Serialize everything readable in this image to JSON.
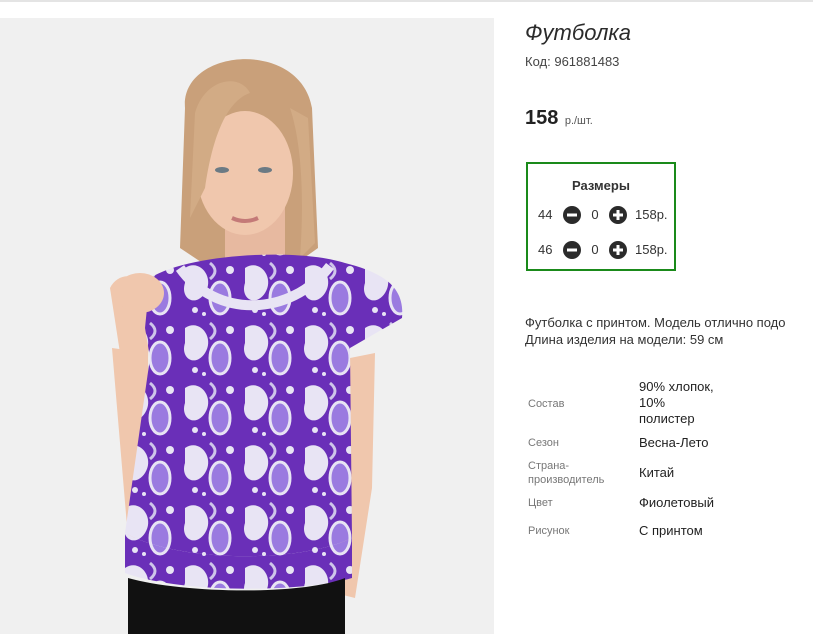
{
  "product": {
    "title": "Футболка",
    "code_label": "Код:",
    "code": "961881483",
    "price": "158",
    "price_unit": "р./шт."
  },
  "sizes": {
    "heading": "Размеры",
    "rows": [
      {
        "size": "44",
        "qty": "0",
        "price": "158р."
      },
      {
        "size": "46",
        "qty": "0",
        "price": "158р."
      }
    ]
  },
  "description": {
    "line1": "Футболка с принтом. Модель отлично подо",
    "line2": "Длина изделия на модели: 59 см"
  },
  "properties": [
    {
      "label": "Состав",
      "value_lines": [
        "90% хлопок,",
        "10%",
        "полистер"
      ]
    },
    {
      "label": "Сезон",
      "value_lines": [
        "Весна-Лето"
      ]
    },
    {
      "label_lines": [
        "Страна-",
        "производитель"
      ],
      "value_lines": [
        "Китай"
      ]
    },
    {
      "label": "Цвет",
      "value_lines": [
        "Фиолетовый"
      ]
    },
    {
      "label": "Рисунок",
      "value_lines": [
        "С принтом"
      ]
    }
  ],
  "colors": {
    "accent_border": "#1a8a1a",
    "shirt_purple": "#6a2fb8",
    "button_dark": "#2b2b2b"
  },
  "icons": [
    "minus-circle-icon",
    "plus-circle-icon"
  ]
}
